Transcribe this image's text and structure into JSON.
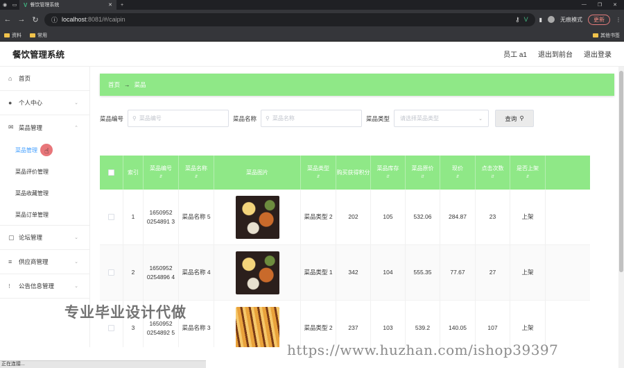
{
  "browser": {
    "tab_title": "餐饮管理系统",
    "url_host": "localhost",
    "url_rest": ":8081/#/caipin",
    "incognito_label": "无痕模式",
    "update_label": "更新",
    "bookmarks": [
      "资料",
      "常用"
    ],
    "other_bookmarks": "其他书签"
  },
  "app": {
    "title": "餐饮管理系统",
    "user": "员工 a1",
    "back_front": "退出到前台",
    "logout": "退出登录"
  },
  "sidebar": {
    "home": "首页",
    "personal": "个人中心",
    "dish_mgmt": "菜品管理",
    "sub": [
      "菜品管理",
      "菜品评价管理",
      "菜品收藏管理",
      "菜品订单管理"
    ],
    "forum": "论坛管理",
    "supplier": "供应商管理",
    "notice": "公告信息管理"
  },
  "breadcrumb": {
    "home": "首页",
    "current": "菜品"
  },
  "search": {
    "code_label": "菜品编号",
    "code_placeholder": "菜品编号",
    "name_label": "菜品名称",
    "name_placeholder": "菜品名称",
    "type_label": "菜品类型",
    "type_placeholder": "请选择菜品类型",
    "query_button": "查询"
  },
  "table": {
    "headers": [
      "索引",
      "菜品编号",
      "菜品名称",
      "菜品图片",
      "菜品类型",
      "购买获得积分",
      "菜品库存",
      "菜品原价",
      "现价",
      "点击次数",
      "是否上架"
    ],
    "rows": [
      {
        "index": "1",
        "code": "1650952 0254891 3",
        "name": "菜品名称 5",
        "type": "菜品类型 2",
        "points": "202",
        "stock": "105",
        "orig": "532.06",
        "now": "284.87",
        "clicks": "23",
        "onsale": "上架"
      },
      {
        "index": "2",
        "code": "1650952 0254896 4",
        "name": "菜品名称 4",
        "type": "菜品类型 1",
        "points": "342",
        "stock": "104",
        "orig": "555.35",
        "now": "77.67",
        "clicks": "27",
        "onsale": "上架"
      },
      {
        "index": "3",
        "code": "1650952 0254892 5",
        "name": "菜品名称 3",
        "type": "菜品类型 2",
        "points": "237",
        "stock": "103",
        "orig": "539.2",
        "now": "140.05",
        "clicks": "107",
        "onsale": "上架"
      }
    ]
  },
  "overlay": {
    "watermark_cn": "专业毕业设计代做",
    "watermark_url": "https://www.huzhan.com/ishop39397",
    "status_text": "正在连接..."
  },
  "colors": {
    "accent_green": "#8fe887",
    "active_blue": "#409eff"
  }
}
